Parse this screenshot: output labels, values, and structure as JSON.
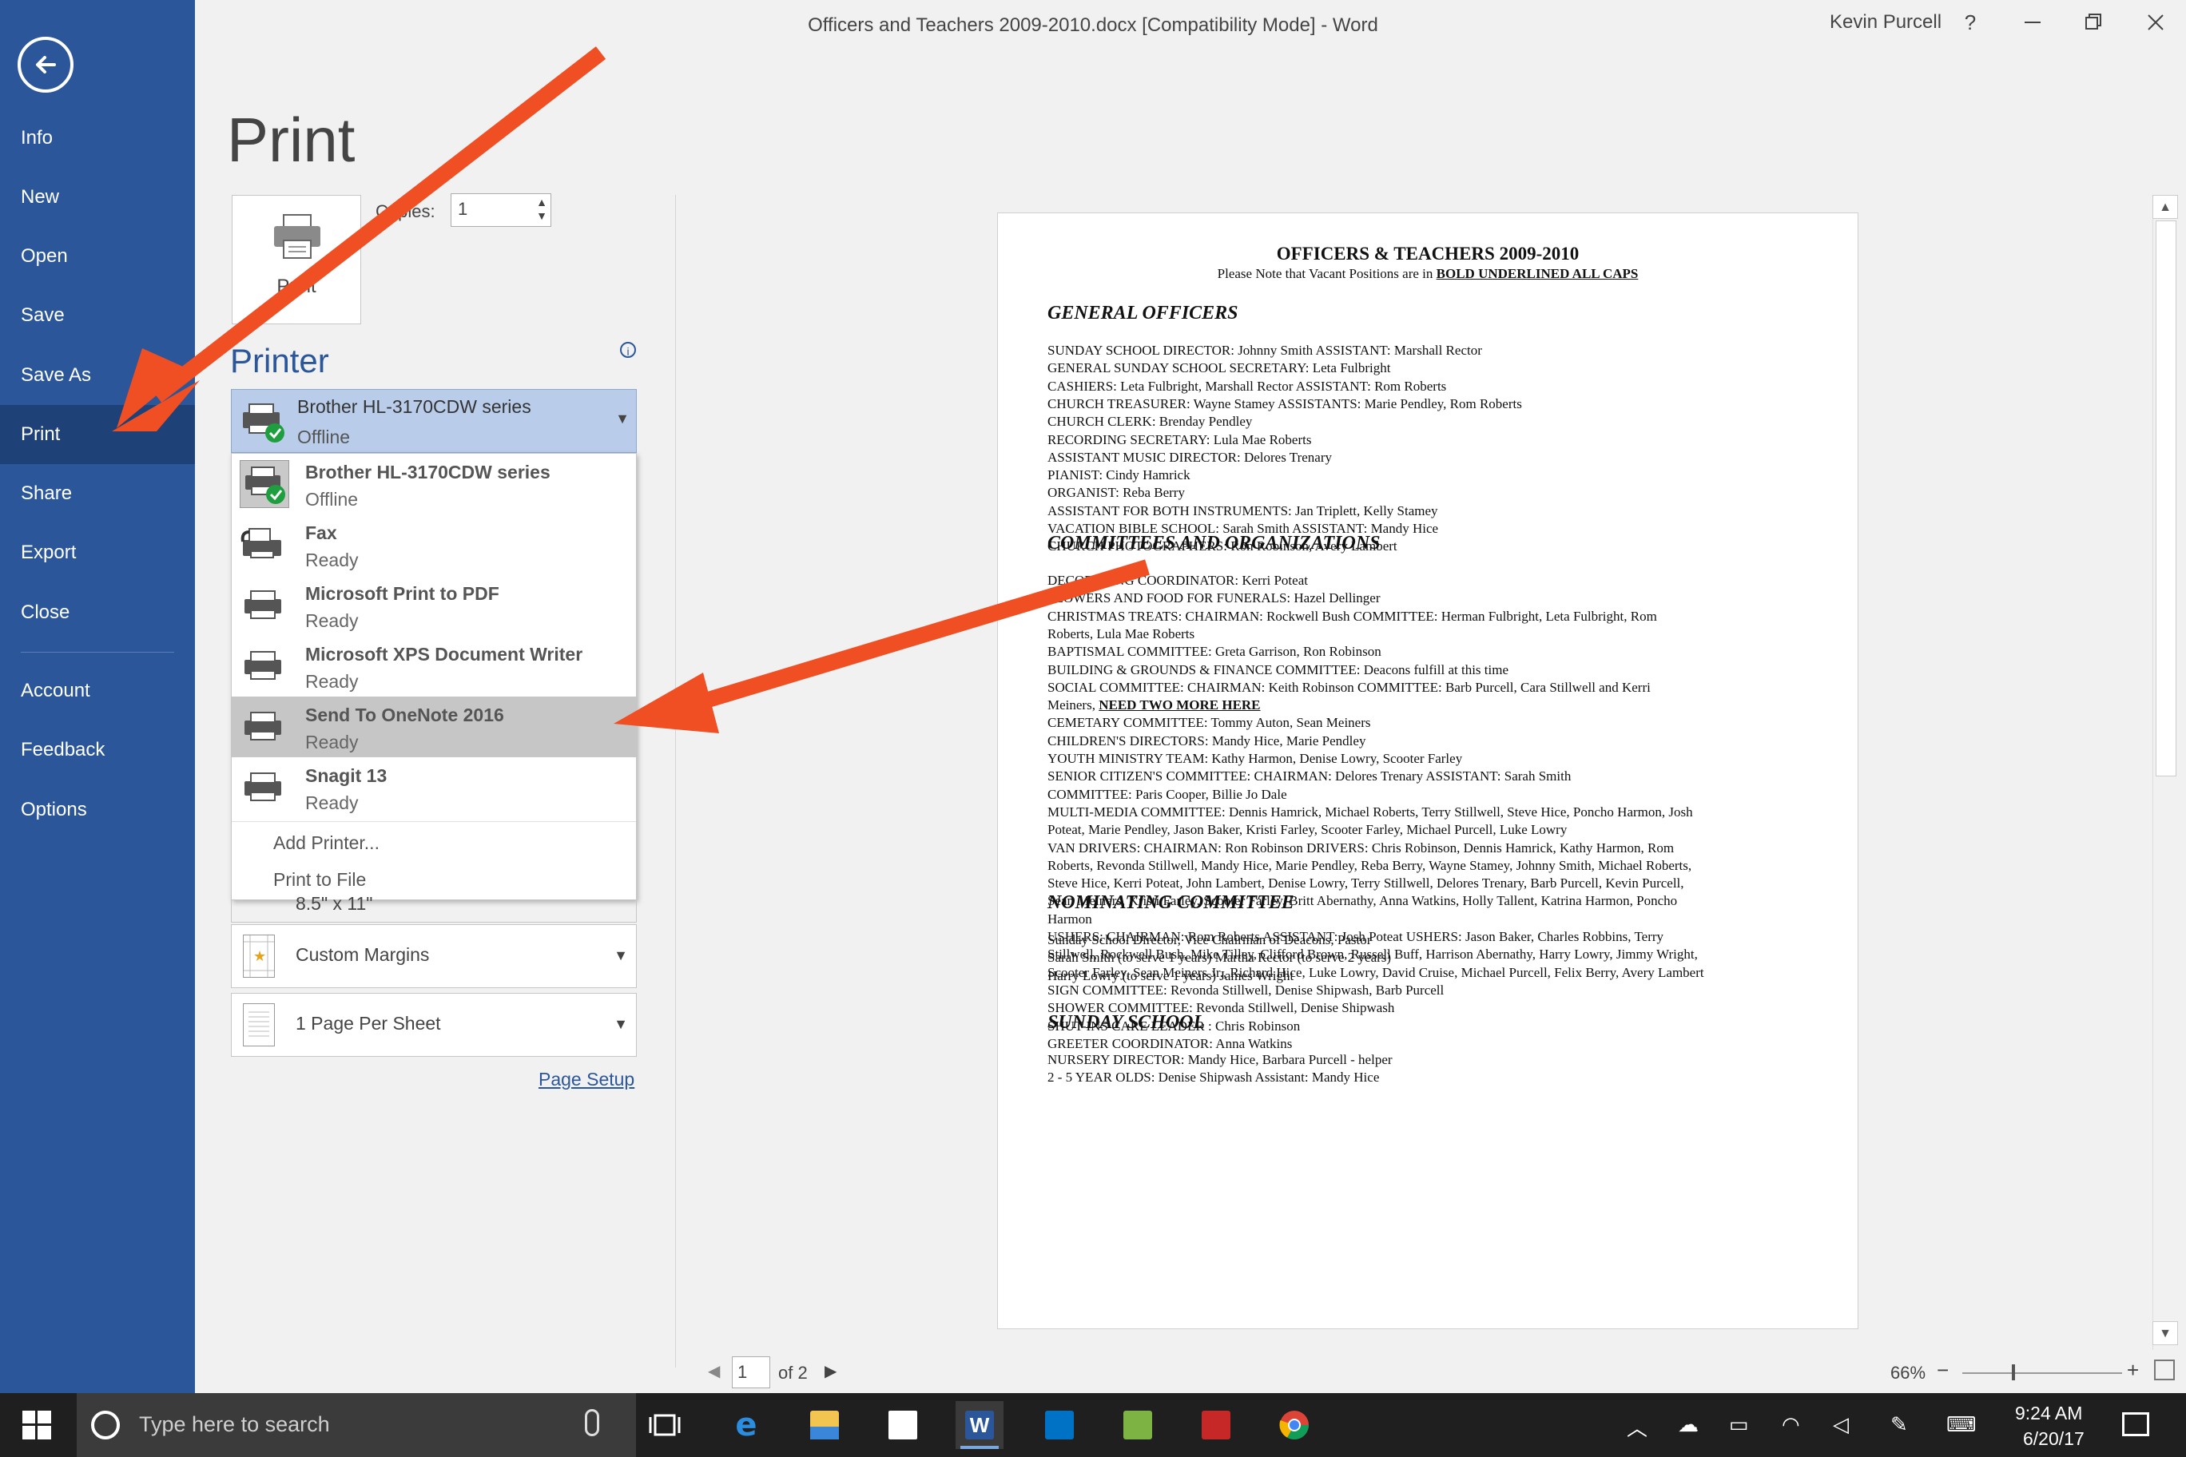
{
  "window": {
    "title": "Officers and Teachers 2009-2010.docx [Compatibility Mode]  -  Word",
    "user": "Kevin Purcell",
    "help_icon": "?",
    "controls": [
      "minimize-icon",
      "restore-icon",
      "close-icon"
    ]
  },
  "sidebar": {
    "items": [
      {
        "label": "Info"
      },
      {
        "label": "New"
      },
      {
        "label": "Open"
      },
      {
        "label": "Save"
      },
      {
        "label": "Save As"
      },
      {
        "label": "Print"
      },
      {
        "label": "Share"
      },
      {
        "label": "Export"
      },
      {
        "label": "Close"
      },
      {
        "label": "Account"
      },
      {
        "label": "Feedback"
      },
      {
        "label": "Options"
      }
    ],
    "active": "Print",
    "bg_color": "#2b579a"
  },
  "print": {
    "heading": "Print",
    "button_label": "Print",
    "copies_label": "Copies:",
    "copies_value": "1",
    "printer_heading": "Printer",
    "info_icon": "i",
    "selected_printer": {
      "name": "Brother HL-3170CDW series",
      "status": "Offline"
    },
    "printers": [
      {
        "name": "Brother HL-3170CDW series",
        "status": "Offline"
      },
      {
        "name": "Fax",
        "status": "Ready"
      },
      {
        "name": "Microsoft Print to PDF",
        "status": "Ready"
      },
      {
        "name": "Microsoft XPS Document Writer",
        "status": "Ready"
      },
      {
        "name": "Send To OneNote 2016",
        "status": "Ready"
      },
      {
        "name": "Snagit 13",
        "status": "Ready"
      }
    ],
    "highlighted_printer": "Send To OneNote 2016",
    "add_printer": "Add Printer...",
    "print_to_file": "Print to File",
    "paper_size_partial": "8.5\" x 11\"",
    "margins": "Custom Margins",
    "pages_per_sheet": "1 Page Per Sheet",
    "page_setup": "Page Setup"
  },
  "preview": {
    "title": "OFFICERS & TEACHERS 2009-2010",
    "note_prefix": "Please Note that Vacant Positions are in ",
    "note_emphasis": "BOLD UNDERLINED ALL CAPS",
    "sections": [
      {
        "heading": "GENERAL OFFICERS",
        "lines": [
          "SUNDAY SCHOOL DIRECTOR:  Johnny Smith                ASSISTANT:  Marshall Rector",
          "GENERAL SUNDAY SCHOOL SECRETARY:  Leta Fulbright",
          "CASHIERS:  Leta Fulbright,  Marshall Rector                ASSISTANT:  Rom Roberts",
          "CHURCH TREASURER:  Wayne Stamey                        ASSISTANTS:  Marie Pendley, Rom Roberts",
          "CHURCH CLERK:  Brenday Pendley",
          "RECORDING SECRETARY:  Lula Mae Roberts",
          "ASSISTANT MUSIC DIRECTOR:  Delores Trenary",
          "PIANIST:  Cindy Hamrick",
          "ORGANIST:  Reba Berry",
          "ASSISTANT FOR BOTH INSTRUMENTS:  Jan Triplett, Kelly Stamey",
          "VACATION BIBLE SCHOOL:  Sarah Smith        ASSISTANT:  Mandy Hice",
          "CHURCH PHOTOGRAPHERS:  Ron Robinson, Avery Lambert"
        ]
      },
      {
        "heading": "COMMITTEES AND ORGANIZATIONS",
        "lines": [
          "DECORATING COORDINATOR:  Kerri Poteat",
          "FLOWERS AND FOOD FOR FUNERALS: Hazel Dellinger",
          "CHRISTMAS TREATS:  CHAIRMAN:   Rockwell Bush    COMMITTEE:  Herman Fulbright, Leta Fulbright, Rom",
          "Roberts, Lula Mae Roberts",
          "BAPTISMAL COMMITTEE:   Greta Garrison, Ron Robinson",
          "BUILDING & GROUNDS & FINANCE COMMITTEE:  Deacons fulfill at this time",
          "SOCIAL COMMITTEE:  CHAIRMAN: Keith Robinson       COMMITTEE:   Barb Purcell, Cara Stillwell and Kerri",
          "Meiners, NEED TWO MORE HERE",
          "CEMETARY COMMITTEE:  Tommy Auton, Sean Meiners",
          "CHILDREN'S DIRECTORS:  Mandy Hice, Marie Pendley",
          "YOUTH MINISTRY TEAM:  Kathy Harmon, Denise Lowry, Scooter Farley",
          "SENIOR CITIZEN'S COMMITTEE:   CHAIRMAN:  Delores Trenary          ASSISTANT:   Sarah Smith",
          "COMMITTEE:  Paris Cooper, Billie Jo Dale",
          "MULTI-MEDIA COMMITTEE:  Dennis Hamrick, Michael Roberts, Terry Stillwell, Steve Hice, Poncho Harmon, Josh",
          "Poteat, Marie Pendley, Jason Baker,  Kristi Farley, Scooter Farley,  Michael Purcell, Luke Lowry",
          "VAN DRIVERS:  CHAIRMAN:  Ron Robinson       DRIVERS:  Chris Robinson, Dennis Hamrick, Kathy Harmon, Rom",
          "Roberts, Revonda Stillwell, Mandy Hice, Marie Pendley, Reba Berry, Wayne Stamey, Johnny Smith, Michael Roberts,",
          "Steve Hice, Kerri Poteat, John Lambert, Denise Lowry, Terry Stillwell, Delores Trenary, Barb Purcell, Kevin Purcell,",
          "Sean Meiners, Kristi Farley, Scooter Farley, Britt Abernathy, Anna Watkins, Holly Tallent, Katrina Harmon, Poncho",
          "Harmon",
          "USHERS:  CHAIRMAN:  Rom Roberts        ASSISTANT:  Josh Poteat     USHERS:  Jason Baker, Charles Robbins, Terry",
          "Stillwell, Rockwell Bush,  Mike Tilley,  Clifford Brown,  Russell Buff, Harrison Abernathy, Harry Lowry, Jimmy Wright,",
          "Scooter Farley, Sean Meiners Jr., Richard Hice, Luke Lowry, David Cruise, Michael Purcell, Felix Berry, Avery Lambert",
          "SIGN COMMITTEE:  Revonda Stillwell, Denise Shipwash, Barb Purcell",
          "SHOWER COMMITTEE:  Revonda Stillwell, Denise Shipwash",
          "SHUT-INS CARE LEADER :  Chris Robinson",
          "GREETER COORDINATOR:   Anna Watkins"
        ]
      },
      {
        "heading": "NOMINATING COMMITTEE",
        "lines": [
          "Sunday School Director, Vice Chairman of Deacons, Pastor",
          "Sarah Smith (to serve 1 years)                   Martha Rector (to serve 2 years)",
          "Harry Lowry (to serve 1 years)                   James Wright"
        ]
      },
      {
        "heading": "SUNDAY SCHOOL",
        "lines": [
          "NURSERY DIRECTOR:   Mandy Hice, Barbara Purcell - helper",
          "2 - 5 YEAR OLDS:  Denise Shipwash    Assistant:  Mandy Hice"
        ]
      }
    ]
  },
  "page_nav": {
    "current": "1",
    "of_label": "of 2"
  },
  "zoom": {
    "level": "66%",
    "minus": "−",
    "plus": "+"
  },
  "taskbar": {
    "search_placeholder": "Type here to search",
    "apps": [
      "task-view-icon",
      "edge-icon",
      "file-explorer-icon",
      "store-icon",
      "word-icon",
      "outlook-icon",
      "app-green-icon",
      "app-red-icon",
      "chrome-icon"
    ],
    "time": "9:24 AM",
    "date": "6/20/17"
  },
  "annotations": {
    "arrow_color": "#f04e23"
  }
}
